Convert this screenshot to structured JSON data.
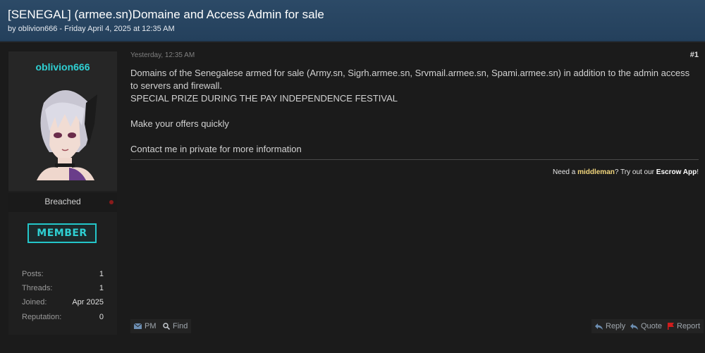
{
  "thread": {
    "title": "[SENEGAL] (armee.sn)Domaine and Access Admin for sale",
    "meta_by": "by ",
    "meta_author": "oblivion666",
    "meta_date": " - Friday April 4, 2025 at 12:35 AM"
  },
  "user": {
    "name": "oblivion666",
    "rank": "Breached",
    "badge": "MEMBER",
    "stats": [
      {
        "label": "Posts:",
        "value": "1"
      },
      {
        "label": "Threads:",
        "value": "1"
      },
      {
        "label": "Joined:",
        "value": "Apr 2025"
      },
      {
        "label": "Reputation:",
        "value": "0"
      }
    ]
  },
  "post": {
    "date": "Yesterday, 12:35 AM",
    "number": "#1",
    "lines": [
      "Domains of the Senegalese armed for sale (Army.sn, Sigrh.armee.sn, Srvmail.armee.sn, Spami.armee.sn) in addition to the admin access to servers and firewall.",
      "SPECIAL PRIZE DURING THE PAY INDEPENDENCE FESTIVAL",
      "Make your offers quickly",
      "Contact me in private for more information"
    ],
    "signature": {
      "pre": "Need a ",
      "middleman": "middleman",
      "mid": "? Try out our ",
      "escrow": "Escrow App",
      "post": "!"
    }
  },
  "actions": {
    "pm": "PM",
    "find": "Find",
    "reply": "Reply",
    "quote": "Quote",
    "report": "Report"
  },
  "colors": {
    "header_bg": "#2c4a67",
    "username": "#2fd0d3",
    "badge_border": "#24c6c9",
    "report_flag": "#d11c1c"
  }
}
